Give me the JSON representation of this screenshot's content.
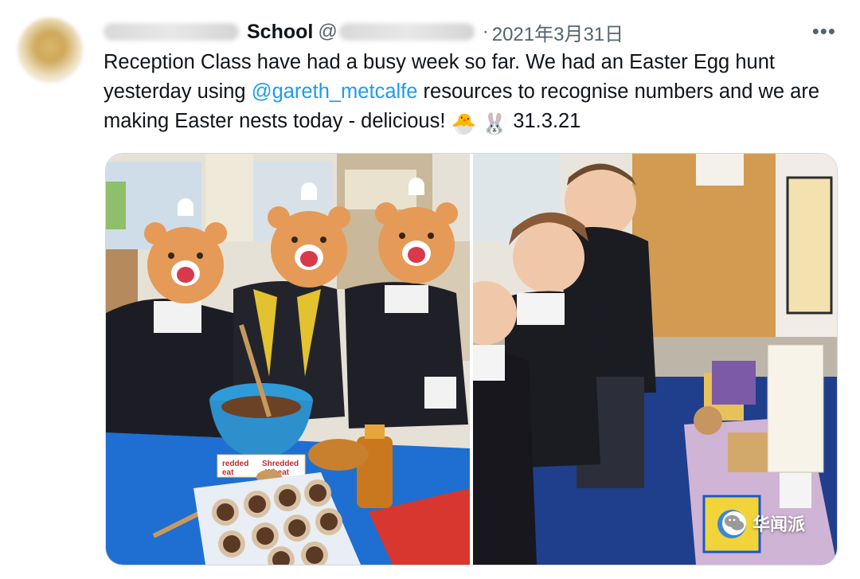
{
  "tweet": {
    "display_name": "School",
    "at_sign": "@",
    "separator": "·",
    "date": "2021年3月31日",
    "more": "•••",
    "text_part1": "Reception Class have had a busy week so far. We had an Easter Egg hunt yesterday using ",
    "mention": "@gareth_metcalfe",
    "text_part2": " resources to recognise numbers and we are making Easter nests today - delicious! ",
    "emoji_chick": "🐣",
    "emoji_rabbit": "🐰",
    "text_date": " 31.3.21"
  },
  "media": {
    "left_photo": {
      "box_label_1": "Shredded",
      "box_label_2": "Wheat",
      "box_label_3": "redded",
      "box_label_4": "eat"
    }
  },
  "watermark": {
    "text": "华闻派"
  },
  "colors": {
    "accent": "#1d9bf0",
    "text": "#0f1419",
    "secondary": "#536471"
  }
}
